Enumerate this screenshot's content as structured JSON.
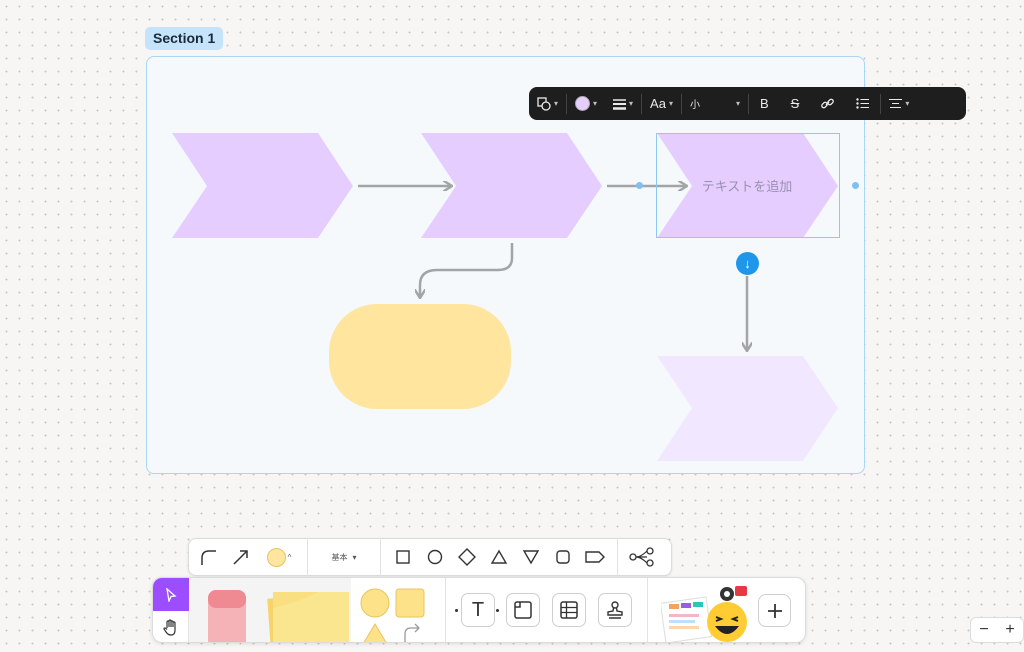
{
  "section": {
    "title": "Section 1"
  },
  "canvas": {
    "selected_shape_placeholder": "テキストを追加",
    "colors": {
      "chevron": "#e5ceff",
      "chevron_faded": "#f1e8ff",
      "rounded_rect": "#ffe59e",
      "arrow": "#a4a4a4",
      "selection": "#8ccaf3"
    }
  },
  "floating_toolbar": {
    "shape_icon": "shapes-icon",
    "fill_color": "#e5ceff",
    "stroke_icon": "stroke-weight-icon",
    "font_label": "Aa",
    "size_label": "小",
    "bold_label": "B",
    "strikethrough_icon": "strikethrough-icon",
    "link_icon": "link-icon",
    "list_icon": "bulleted-list-icon",
    "align_icon": "align-center-icon"
  },
  "shape_bar": {
    "connector_icon": "elbow-connector-icon",
    "arrow_icon": "straight-arrow-icon",
    "fill_color": "#ffe59e",
    "line_style_label": "基本",
    "shapes": [
      "square",
      "circle",
      "diamond",
      "triangle",
      "triangle-down",
      "rounded-square",
      "chevron-tag"
    ],
    "mindmap_icon": "mindmap-icon"
  },
  "main_bar": {
    "tools": [
      "pointer-icon",
      "hand-icon",
      "marker-tool",
      "sticky-notes",
      "shapes-tool",
      "text-tool",
      "section-tool",
      "table-tool",
      "stamp-tool",
      "templates-tool",
      "add-button"
    ],
    "text_tool_label": "T"
  },
  "zoom": {
    "minus_label": "−",
    "plus_label": "+"
  }
}
